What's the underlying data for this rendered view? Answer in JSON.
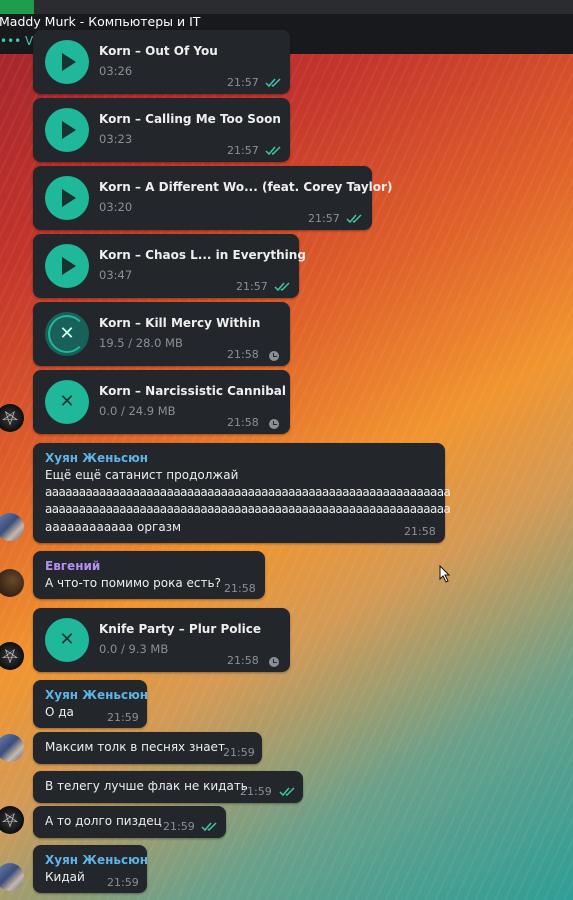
{
  "window": {
    "title": "Maddy Murk - Компьютеры и IT",
    "typing": "••• Vladislav и Евгений печатают"
  },
  "audio_messages": [
    {
      "title": "Korn – Out Of You",
      "meta": "03:26",
      "time": "21:57",
      "state": "play",
      "status": "read"
    },
    {
      "title": "Korn – Calling Me Too Soon",
      "meta": "03:23",
      "time": "21:57",
      "state": "play",
      "status": "read"
    },
    {
      "title": "Korn – A Different Wo... (feat. Corey Taylor)",
      "meta": "03:20",
      "time": "21:57",
      "state": "play",
      "status": "read"
    },
    {
      "title": "Korn – Chaos L... in Everything",
      "meta": "03:47",
      "time": "21:57",
      "state": "play",
      "status": "read"
    },
    {
      "title": "Korn – Kill Mercy Within",
      "meta": "19.5 / 28.0 MB",
      "time": "21:58",
      "state": "downloading",
      "status": "pending"
    },
    {
      "title": "Korn – Narcissistic Cannibal",
      "meta": "0.0 / 24.9 MB",
      "time": "21:58",
      "state": "cancel",
      "status": "pending"
    },
    {
      "title": "Knife Party – Plur Police",
      "meta": "0.0 / 9.3 MB",
      "time": "21:58",
      "state": "cancel",
      "status": "pending"
    }
  ],
  "text_messages": [
    {
      "sender": "Хуян Женьсюн",
      "lines": [
        "Ещё ещё сатанист продолжай",
        "аааааааааааааааааааааааааааааааааааааааааааааааааааааааааааа",
        "аааааааааааааааааааааааааааааааааааааааааааааааааааааааааааа",
        "аааааааааааа оргазм"
      ],
      "time": "21:58"
    },
    {
      "sender": "Евгений",
      "lines": [
        "А что-то помимо рока есть?"
      ],
      "time": "21:58"
    },
    {
      "sender": "Хуян Женьсюн",
      "lines": [
        "О да"
      ],
      "time": "21:59"
    },
    {
      "sender": "",
      "lines": [
        "Максим толк в песнях знает"
      ],
      "time": "21:59"
    },
    {
      "sender": "",
      "lines": [
        "В телегу лучше флак не кидать"
      ],
      "time": "21:59",
      "status": "read"
    },
    {
      "sender": "",
      "lines": [
        "А то долго пиздец"
      ],
      "time": "21:59",
      "status": "read"
    },
    {
      "sender": "Хуян Женьсюн",
      "lines": [
        "Кидай"
      ],
      "time": "21:59"
    }
  ],
  "colors": {
    "accent": "#1fb89a",
    "sender_blue": "#5fb3e6",
    "sender_purple": "#b48ef0",
    "typing": "#3ecbb0",
    "bubble": "#23272c"
  },
  "icons": {
    "read_receipt": "double-check-icon",
    "pending": "clock-icon",
    "play": "play-icon",
    "cancel": "close-icon"
  }
}
